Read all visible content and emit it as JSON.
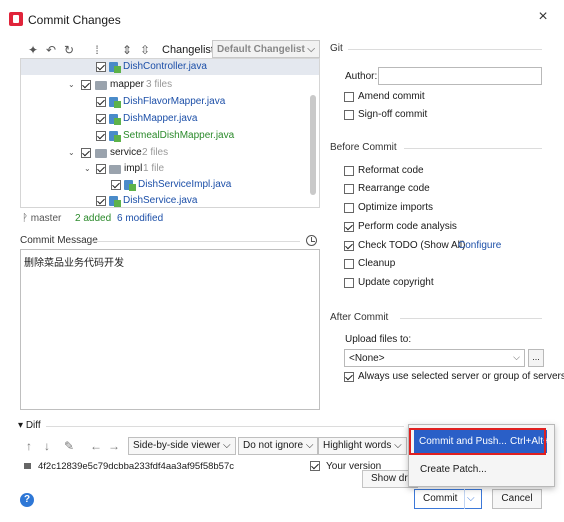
{
  "window": {
    "title": "Commit Changes"
  },
  "toolbar": {
    "changelist_label": "Changelist:",
    "changelist_value": "Default Changelist"
  },
  "tree": [
    {
      "label": "DishController.java",
      "kind": "file",
      "color": "blue",
      "checked": true
    },
    {
      "label": "mapper",
      "count": "3 files",
      "kind": "folder",
      "checked": true
    },
    {
      "label": "DishFlavorMapper.java",
      "kind": "file",
      "color": "blue",
      "checked": true
    },
    {
      "label": "DishMapper.java",
      "kind": "file",
      "color": "blue",
      "checked": true
    },
    {
      "label": "SetmealDishMapper.java",
      "kind": "file",
      "color": "green",
      "checked": true
    },
    {
      "label": "service",
      "count": "2 files",
      "kind": "folder",
      "checked": true
    },
    {
      "label": "impl",
      "count": "1 file",
      "kind": "folder",
      "checked": true
    },
    {
      "label": "DishServiceImpl.java",
      "kind": "file",
      "color": "blue",
      "checked": true
    },
    {
      "label": "DishService.java",
      "kind": "file",
      "color": "blue",
      "checked": true
    }
  ],
  "status": {
    "branch": "master",
    "added": "2 added",
    "modified": "6 modified"
  },
  "commit_message": {
    "label": "Commit Message",
    "text": "删除菜品业务代码开发"
  },
  "git": {
    "section": "Git",
    "author_label": "Author:",
    "author_value": "",
    "amend": "Amend commit",
    "signoff": "Sign-off commit"
  },
  "before_commit": {
    "section": "Before Commit",
    "options": [
      {
        "label": "Reformat code",
        "checked": false
      },
      {
        "label": "Rearrange code",
        "checked": false
      },
      {
        "label": "Optimize imports",
        "checked": false
      },
      {
        "label": "Perform code analysis",
        "checked": true
      },
      {
        "label": "Check TODO (Show All)",
        "checked": true,
        "link": "Configure"
      },
      {
        "label": "Cleanup",
        "checked": false
      },
      {
        "label": "Update copyright",
        "checked": false
      }
    ]
  },
  "after_commit": {
    "section": "After Commit",
    "upload_label": "Upload files to:",
    "upload_value": "<None>",
    "more": "...",
    "always_use": "Always use selected server or group of servers"
  },
  "diff": {
    "label": "Diff",
    "viewer": "Side-by-side viewer",
    "ignore": "Do not ignore",
    "highlight": "Highlight words",
    "hash": "4f2c12839e5c79dcbba233fdf4aa3af95f58b57c",
    "your_version": "Your version"
  },
  "popup": {
    "commit_push": "Commit and Push...",
    "shortcut": "Ctrl+Alt+K",
    "create_patch": "Create Patch...",
    "tooltip": "Show drop"
  },
  "buttons": {
    "commit": "Commit",
    "cancel": "Cancel",
    "help": "?"
  },
  "colors": {
    "accent": "#2a5fc7",
    "highlight_box": "#e02020",
    "added": "#2b8a2b",
    "modified": "#1c4fa8"
  }
}
